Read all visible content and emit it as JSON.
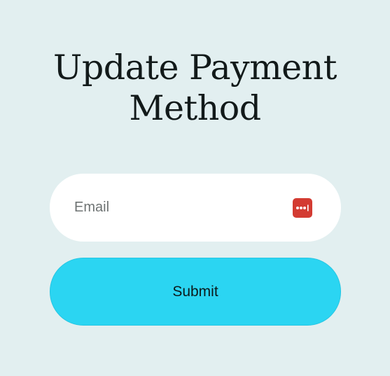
{
  "title": {
    "line1": "Update Payment",
    "line2": "Method"
  },
  "form": {
    "email_placeholder": "Email",
    "email_value": "",
    "password_manager_icon": "password-manager-icon",
    "submit_label": "Submit"
  },
  "colors": {
    "background": "#e2eff0",
    "input_background": "#ffffff",
    "submit_background": "#2bd5f2",
    "password_manager_icon": "#d33b32"
  }
}
